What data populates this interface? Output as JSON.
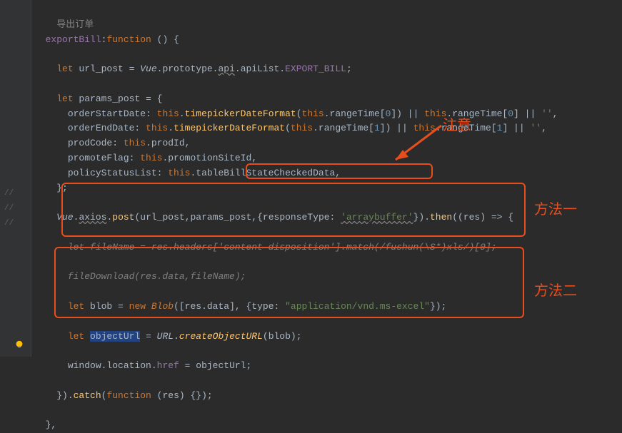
{
  "gutter": {
    "m1": "//",
    "m2": "//",
    "m3": "//"
  },
  "annotations": {
    "note": "注意",
    "method1": "方法一",
    "method2": "方法二"
  },
  "code": {
    "l1_comment": "导出订单",
    "l2_a": "exportBill",
    "l2_b": ":",
    "l2_c": "function",
    "l2_d": " () {",
    "l4_a": "let",
    "l4_b": " url_post = ",
    "l4_c": "Vue",
    "l4_d": ".prototype.",
    "l4_e": "api",
    "l4_f": ".apiList.",
    "l4_g": "EXPORT_BILL",
    "l4_h": ";",
    "l6_a": "let",
    "l6_b": " params_post = {",
    "l7_a": "orderStartDate: ",
    "l7_b": "this",
    "l7_c": ".",
    "l7_d": "timepickerDateFormat",
    "l7_e": "(",
    "l7_f": "this",
    "l7_g": ".rangeTime[",
    "l7_h": "0",
    "l7_i": "]) || ",
    "l7_j": "this",
    "l7_k": ".rangeTime[",
    "l7_l": "0",
    "l7_m": "] || ",
    "l7_n": "''",
    "l7_o": ",",
    "l8_a": "orderEndDate: ",
    "l8_b": "this",
    "l8_c": ".",
    "l8_d": "timepickerDateFormat",
    "l8_e": "(",
    "l8_f": "this",
    "l8_g": ".rangeTime[",
    "l8_h": "1",
    "l8_i": "]) || ",
    "l8_j": "this",
    "l8_k": ".rangeTime[",
    "l8_l": "1",
    "l8_m": "] || ",
    "l8_n": "''",
    "l8_o": ",",
    "l9_a": "prodCode: ",
    "l9_b": "this",
    "l9_c": ".prodId,",
    "l10_a": "promoteFlag: ",
    "l10_b": "this",
    "l10_c": ".promotionSiteId,",
    "l11_a": "policyStatusList: ",
    "l11_b": "this",
    "l11_c": ".tableBillStateCheckedData,",
    "l12_a": "};",
    "l14_a": "Vue",
    "l14_b": ".",
    "l14_c": "axios",
    "l14_d": ".",
    "l14_e": "post",
    "l14_f": "(url_post,params_post,",
    "l14_g": "{responseType: ",
    "l14_h": "'arraybuffer'",
    "l14_i": "})",
    "l14_j": ".",
    "l14_k": "then",
    "l14_l": "((res) => {",
    "l16": "let fileName = res.headers['content-disposition'].match(/fushun(\\S*)xls/)[0];",
    "l18": "fileDownload(res.data,fileName);",
    "l20_a": "let",
    "l20_b": " blob = ",
    "l20_c": "new ",
    "l20_d": "Blob",
    "l20_e": "([res.data], {type: ",
    "l20_f": "\"application/vnd.ms-excel\"",
    "l20_g": "});",
    "l22_a": "let",
    "l22_b": " ",
    "l22_c": "objectUrl",
    "l22_d": " = ",
    "l22_e": "URL",
    "l22_f": ".",
    "l22_g": "createObjectURL",
    "l22_h": "(blob);",
    "l24_a": "window.location.",
    "l24_b": "href",
    "l24_c": " = objectUrl;",
    "l26_a": "}).",
    "l26_b": "catch",
    "l26_c": "(",
    "l26_d": "function",
    "l26_e": " (res) {});",
    "l28": "},"
  }
}
